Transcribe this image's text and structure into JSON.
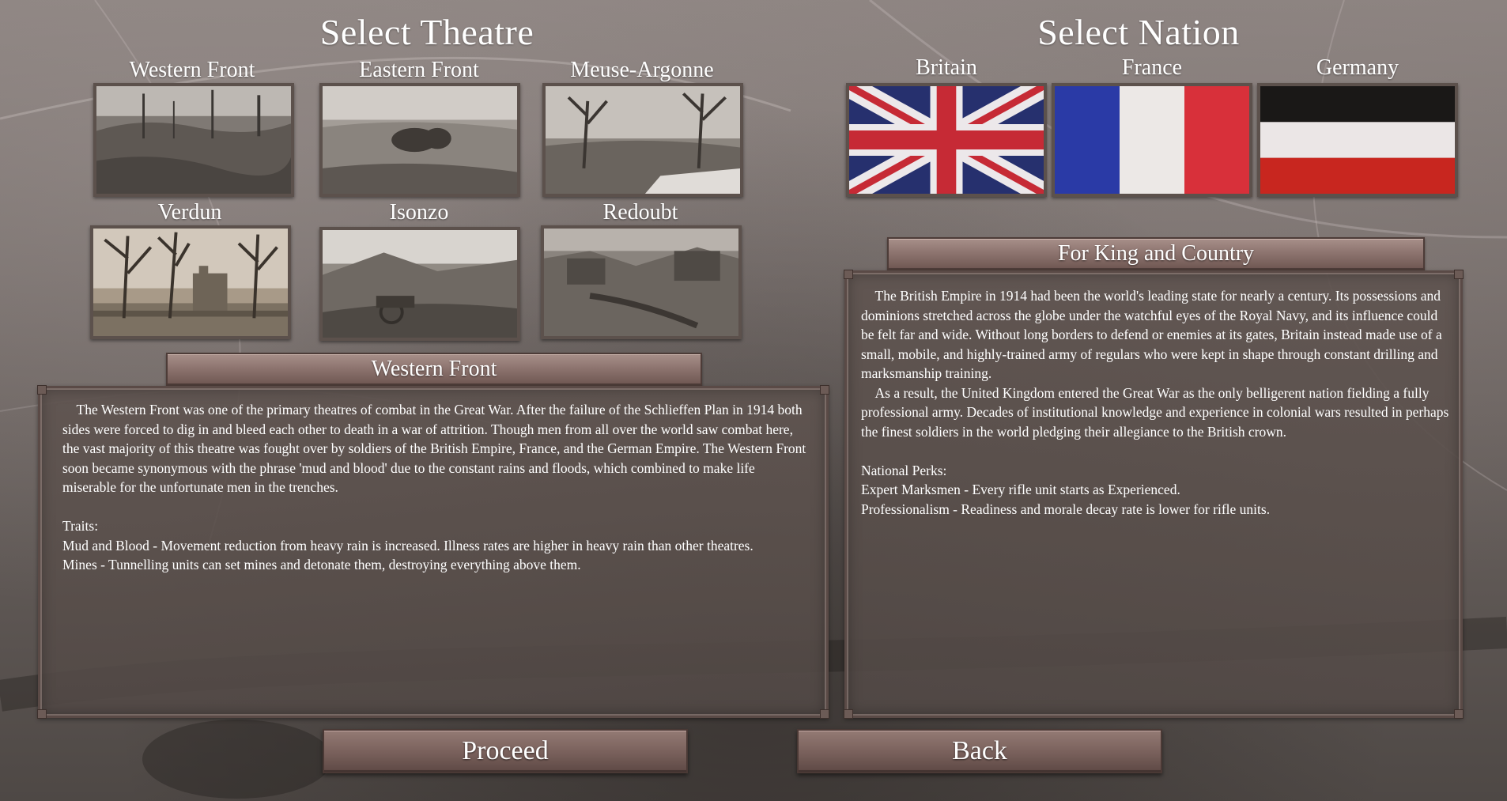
{
  "theatre_section": {
    "heading": "Select Theatre",
    "theatres": [
      {
        "label": "Western Front"
      },
      {
        "label": "Eastern Front"
      },
      {
        "label": "Meuse-Argonne"
      },
      {
        "label": "Verdun"
      },
      {
        "label": "Isonzo"
      },
      {
        "label": "Redoubt"
      }
    ],
    "selected_title": "Western Front",
    "description": "    The Western Front was one of the primary theatres of combat in the Great War. After the failure of the Schlieffen Plan in 1914 both sides were forced to dig in and bleed each other to death in a war of attrition. Though men from all over the world saw combat here, the vast majority of this theatre was fought over by soldiers of the British Empire, France, and the German Empire. The Western Front soon became synonymous with the phrase 'mud and blood' due to the constant rains and floods, which combined to make life miserable for the unfortunate men in the trenches.\n\nTraits:\nMud and Blood - Movement reduction from heavy rain is increased. Illness rates are higher in heavy rain than other theatres.\nMines - Tunnelling units can set mines and detonate them, destroying everything above them."
  },
  "nation_section": {
    "heading": "Select Nation",
    "nations": [
      {
        "label": "Britain",
        "flag_icon": "union-jack"
      },
      {
        "label": "France",
        "flag_icon": "french-tricolour"
      },
      {
        "label": "Germany",
        "flag_icon": "german-imperial-tricolour"
      }
    ],
    "selected_title": "For King and Country",
    "description": "    The British Empire in 1914 had been the world's leading state for nearly a century. Its possessions and dominions stretched across the globe under the watchful eyes of the Royal Navy, and its influence could be felt far and wide. Without long borders to defend or enemies at its gates, Britain instead made use of a small, mobile, and highly-trained army of regulars who were kept in shape through constant drilling and marksmanship training.\n    As a result, the United Kingdom entered the Great War as the only belligerent nation fielding a fully professional army. Decades of institutional knowledge and experience in colonial wars resulted in perhaps the finest soldiers in the world pledging their allegiance to the British crown.\n\nNational Perks:\nExpert Marksmen - Every rifle unit starts as Experienced.\nProfessionalism - Readiness and morale decay rate is lower for rifle units."
  },
  "buttons": {
    "proceed": "Proceed",
    "back": "Back"
  },
  "colors": {
    "uk_blue": "#26306e",
    "uk_red": "#c62a35",
    "fr_blue": "#2a3aa6",
    "fr_red": "#d8303a",
    "de_black": "#1a1817",
    "de_white": "#ebe6e6",
    "de_red": "#c8261f"
  }
}
